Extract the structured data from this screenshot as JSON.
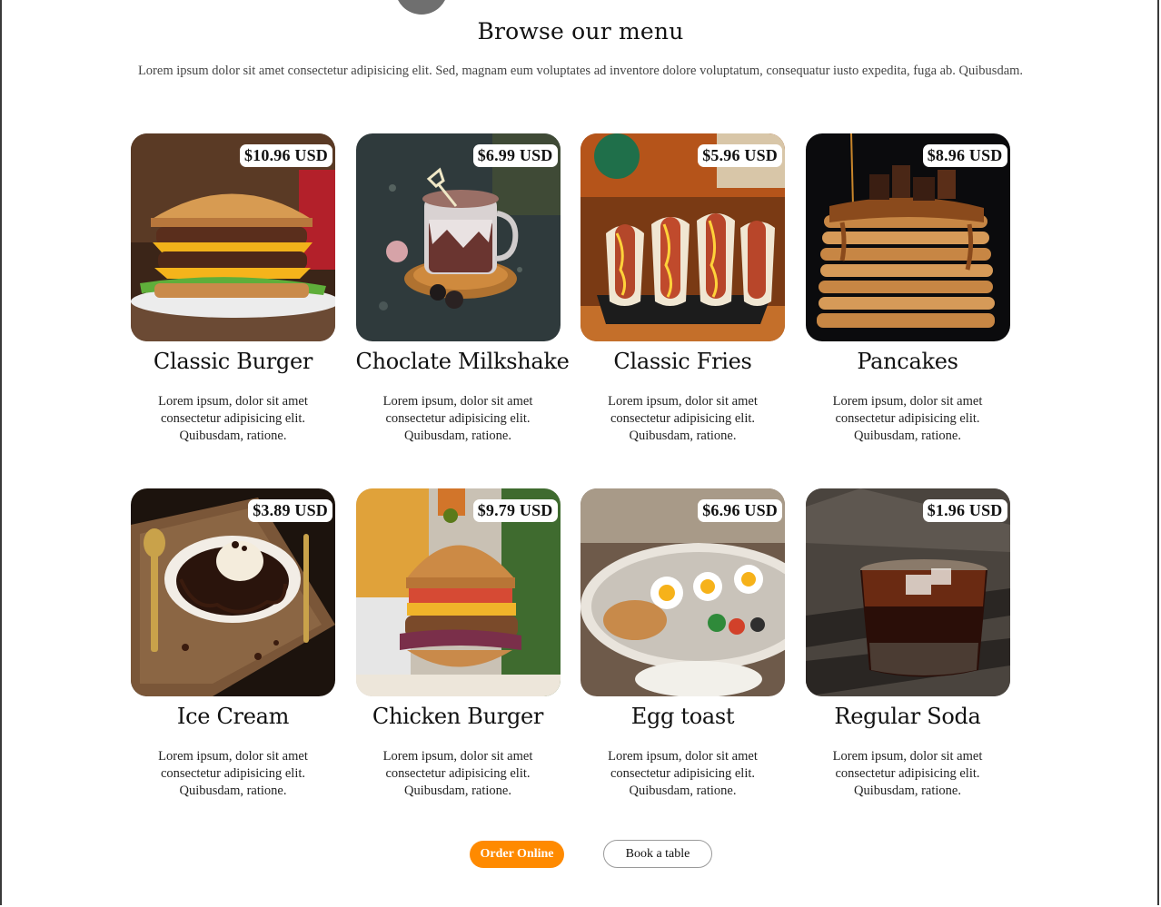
{
  "menu": {
    "title": "Browse our menu",
    "intro": "Lorem ipsum dolor sit amet consectetur adipisicing elit. Sed, magnam eum voluptates ad inventore dolore voluptatum, consequatur iusto expedita, fuga ab. Quibusdam.",
    "items": [
      {
        "name": "Classic Burger",
        "price": "$10.96 USD",
        "description": "Lorem ipsum, dolor sit amet consectetur adipisicing elit. Quibusdam, ratione.",
        "image": "burger-photo"
      },
      {
        "name": "Choclate Milkshake",
        "price": "$6.99 USD",
        "description": "Lorem ipsum, dolor sit amet consectetur adipisicing elit. Quibusdam, ratione.",
        "image": "milkshake-photo"
      },
      {
        "name": "Classic Fries",
        "price": "$5.96 USD",
        "description": "Lorem ipsum, dolor sit amet consectetur adipisicing elit. Quibusdam, ratione.",
        "image": "hotdogs-photo"
      },
      {
        "name": "Pancakes",
        "price": "$8.96 USD",
        "description": "Lorem ipsum, dolor sit amet consectetur adipisicing elit. Quibusdam, ratione.",
        "image": "pancakes-photo"
      },
      {
        "name": "Ice Cream",
        "price": "$3.89 USD",
        "description": "Lorem ipsum, dolor sit amet consectetur adipisicing elit. Quibusdam, ratione.",
        "image": "icecream-photo"
      },
      {
        "name": "Chicken Burger",
        "price": "$9.79 USD",
        "description": "Lorem ipsum, dolor sit amet consectetur adipisicing elit. Quibusdam, ratione.",
        "image": "chicken-burger-photo"
      },
      {
        "name": "Egg toast",
        "price": "$6.96 USD",
        "description": "Lorem ipsum, dolor sit amet consectetur adipisicing elit. Quibusdam, ratione.",
        "image": "egg-toast-photo"
      },
      {
        "name": "Regular Soda",
        "price": "$1.96 USD",
        "description": "Lorem ipsum, dolor sit amet consectetur adipisicing elit. Quibusdam, ratione.",
        "image": "soda-photo"
      }
    ]
  },
  "actions": {
    "order_label": "Order Online",
    "book_label": "Book a table"
  },
  "colors": {
    "accent": "#ff8a00",
    "text": "#111111",
    "muted": "#444444"
  }
}
